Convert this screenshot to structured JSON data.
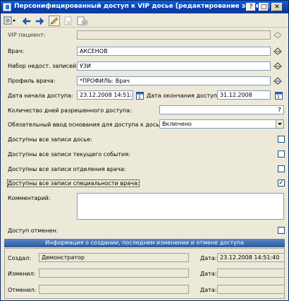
{
  "window": {
    "title": "Персонифицированный доступ к VIP досье [редактирование записи]"
  },
  "titlebar_buttons": {
    "help": "?",
    "maximize": "□",
    "close": "✕"
  },
  "toolbar": {
    "icons": [
      "menu-icon",
      "back-icon",
      "forward-icon",
      "edit-icon",
      "delete-icon",
      "cancel-icon"
    ]
  },
  "form": {
    "vip_patient": {
      "label": "VIP пациент:",
      "value": ""
    },
    "doctor": {
      "label": "Врач:",
      "value": "АКСЕНОВ"
    },
    "unavailable_set": {
      "label": "Набор недост. записей:",
      "value": "УЗИ"
    },
    "doctor_profile": {
      "label": "Профиль врача:",
      "value": "*ПРОФИЛЬ: Врач"
    },
    "access_start": {
      "label": "Дата начала доступа:",
      "value": "23.12.2008 14:51:4"
    },
    "access_end": {
      "label": "Дата окончания доступа:",
      "value": "31.12.2008"
    },
    "days_allowed": {
      "label": "Количество дней разрешенного доступа:",
      "value": "7"
    },
    "reason_required": {
      "label": "Обязательный ввод основания для доступа к досье:",
      "value": "Включено"
    },
    "all_dossier": {
      "label": "Доступны все записи досье:",
      "checked": false
    },
    "all_event": {
      "label": "Доступны все записи текущего события:",
      "checked": false
    },
    "all_department": {
      "label": "Доступны все записи отделения врача:",
      "checked": false
    },
    "all_specialty": {
      "label": "Доступны все записи специальности врача:",
      "checked": true
    },
    "comment": {
      "label": "Комментарий:",
      "value": ""
    },
    "access_revoked": {
      "label": "Доступ отменен:",
      "checked": false
    }
  },
  "info": {
    "header": "Информация о создании, последнем изменении и отмене доступа",
    "created_label": "Создал:",
    "created_by": "Демонстратор",
    "created_date_label": "Дата:",
    "created_date": "23.12.2008 14:51:40",
    "modified_label": "Изменил:",
    "modified_by": "",
    "modified_date_label": "Дата:",
    "modified_date": "",
    "revoked_label": "Отменил:",
    "revoked_by": "",
    "revoked_date_label": "Дата:",
    "revoked_date": ""
  },
  "checkmark": "✓",
  "colors": {
    "title_bar": "#0a3fb0",
    "section_bar": "#2c5aa0",
    "window_bg": "#ece9d8"
  }
}
